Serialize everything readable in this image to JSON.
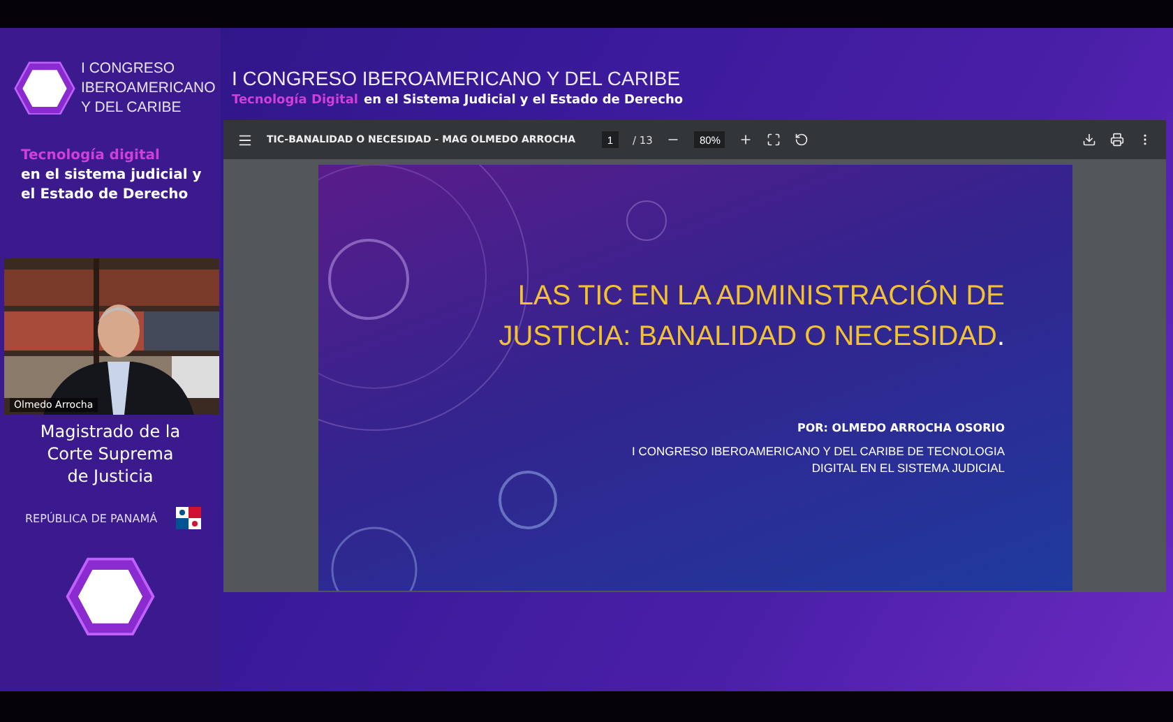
{
  "brand": {
    "lines": [
      "I CONGRESO",
      "IBEROAMERICANO",
      "Y DEL CARIBE"
    ]
  },
  "header": {
    "title": "I CONGRESO IBEROAMERICANO Y DEL CARIBE",
    "highlight": "Tecnología Digital",
    "subtitle": "en el Sistema Judicial y el Estado de Derecho"
  },
  "sidebar": {
    "highlight": "Tecnología digital",
    "lines": [
      "en el sistema judicial y",
      "el Estado de Derecho"
    ],
    "video": {
      "kind": "picture",
      "speaker": "Olmedo Arrocha"
    },
    "role": [
      "Magistrado de la",
      "Corte Suprema",
      "de Justicia"
    ],
    "country": "REPÚBLICA DE PANAMÁ"
  },
  "viewer": {
    "document_title": "TIC-BANALIDAD O NECESIDAD - MAG OLMEDO ARROCHA",
    "page": "1",
    "page_count": "/ 13",
    "zoom": "80%"
  },
  "slide": {
    "title_lines": [
      "LAS TIC EN LA ADMINISTRACIÓN DE",
      "JUSTICIA: BANALIDAD O NECESIDAD"
    ],
    "title_end": ".",
    "author": "POR: OLMEDO ARROCHA OSORIO",
    "event_lines": [
      "I CONGRESO IBEROAMERICANO Y DEL CARIBE DE TECNOLOGIA",
      "DIGITAL EN EL SISTEMA JUDICIAL"
    ]
  }
}
